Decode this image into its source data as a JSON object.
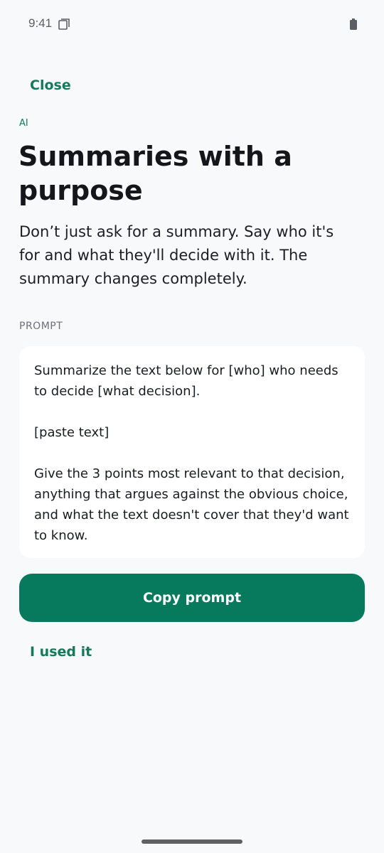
{
  "status_bar": {
    "time": "9:41",
    "screen_icon": "screen-icon",
    "battery_icon": "battery-icon"
  },
  "header": {
    "close_label": "Close"
  },
  "content": {
    "category": "AI",
    "title": "Summaries with a purpose",
    "subtitle": "Don’t just ask for a summary. Say who it's for and what they'll decide with it. The summary changes completely.",
    "prompt_label": "PROMPT",
    "prompt_text": "Summarize the text below for [who] who needs to decide [what decision].\n\n[paste text]\n\nGive the 3 points most relevant to that decision, anything that argues against the obvious choice, and what the text doesn't cover that they'd want to know."
  },
  "actions": {
    "copy_label": "Copy prompt",
    "used_label": "I used it"
  },
  "colors": {
    "accent": "#137a5a",
    "button": "#077a5e",
    "background": "#f7f9fb",
    "card": "#ffffff"
  }
}
